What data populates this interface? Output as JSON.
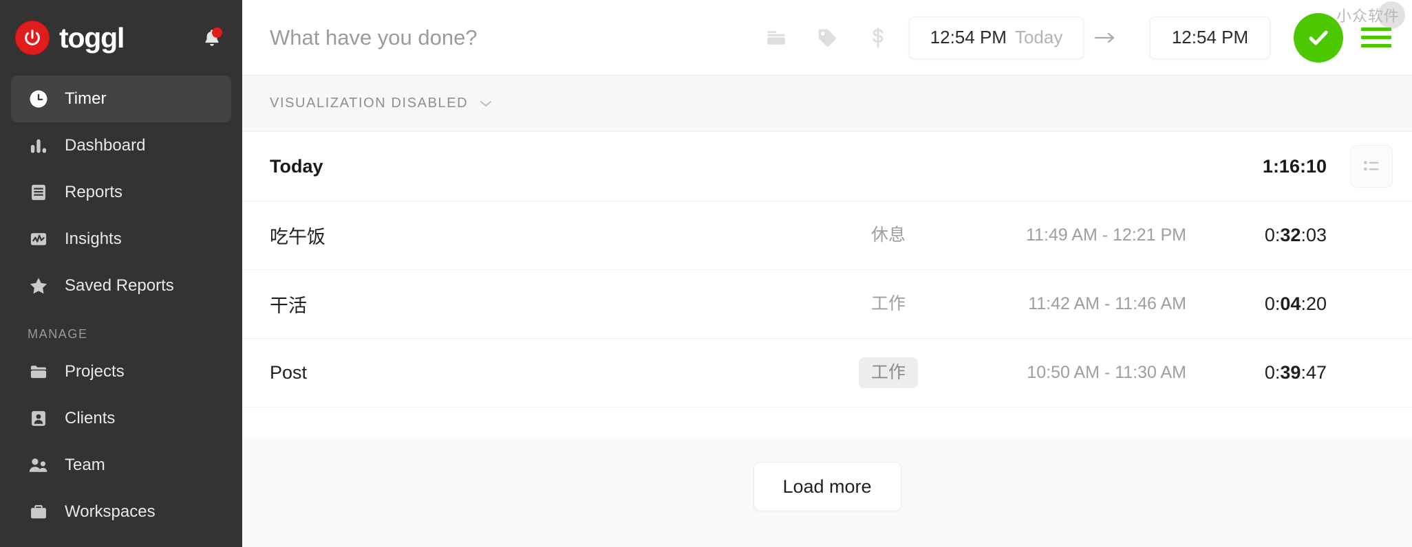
{
  "sidebar": {
    "brand": "toggl",
    "logo_color": "#e01c1c",
    "notification_icon": "bell-icon",
    "has_notification_dot": true,
    "primary_items": [
      {
        "label": "Timer",
        "icon": "clock-icon",
        "active": true
      },
      {
        "label": "Dashboard",
        "icon": "bar-chart-icon",
        "active": false
      },
      {
        "label": "Reports",
        "icon": "document-list-icon",
        "active": false
      },
      {
        "label": "Insights",
        "icon": "line-chart-icon",
        "active": false
      },
      {
        "label": "Saved Reports",
        "icon": "star-icon",
        "active": false
      }
    ],
    "manage_title": "MANAGE",
    "manage_items": [
      {
        "label": "Projects",
        "icon": "folder-icon"
      },
      {
        "label": "Clients",
        "icon": "person-card-icon"
      },
      {
        "label": "Team",
        "icon": "people-icon"
      },
      {
        "label": "Workspaces",
        "icon": "briefcase-icon"
      }
    ]
  },
  "timer_bar": {
    "description_placeholder": "What have you done?",
    "description_value": "",
    "tools": [
      {
        "name": "project-icon",
        "glyph": "folder"
      },
      {
        "name": "tag-icon",
        "glyph": "tag"
      },
      {
        "name": "billable-icon",
        "glyph": "dollar"
      }
    ],
    "start_time": "12:54 PM",
    "start_day": "Today",
    "arrow": "→",
    "end_time": "12:54 PM",
    "start_button_icon": "check-icon",
    "start_button_color": "#4bc800",
    "menu_icon": "hamburger-menu-icon",
    "menu_color": "#4bc800",
    "watermark": "小众软件"
  },
  "visualization": {
    "label": "VISUALIZATION DISABLED",
    "chevron": "chevron-down-icon"
  },
  "day_group": {
    "title": "Today",
    "total": "1:16:10",
    "view_toggle_icon": "list-view-icon"
  },
  "entries": [
    {
      "description": "吃午饭",
      "tag": "休息",
      "tag_highlighted": false,
      "time_range": "11:49 AM - 12:21 PM",
      "duration_prefix": "0:",
      "duration_bold": "32",
      "duration_suffix": ":03"
    },
    {
      "description": "干活",
      "tag": "工作",
      "tag_highlighted": false,
      "time_range": "11:42 AM - 11:46 AM",
      "duration_prefix": "0:",
      "duration_bold": "04",
      "duration_suffix": ":20"
    },
    {
      "description": "Post",
      "tag": "工作",
      "tag_highlighted": true,
      "time_range": "10:50 AM - 11:30 AM",
      "duration_prefix": "0:",
      "duration_bold": "39",
      "duration_suffix": ":47"
    }
  ],
  "footer": {
    "load_more_label": "Load more"
  }
}
